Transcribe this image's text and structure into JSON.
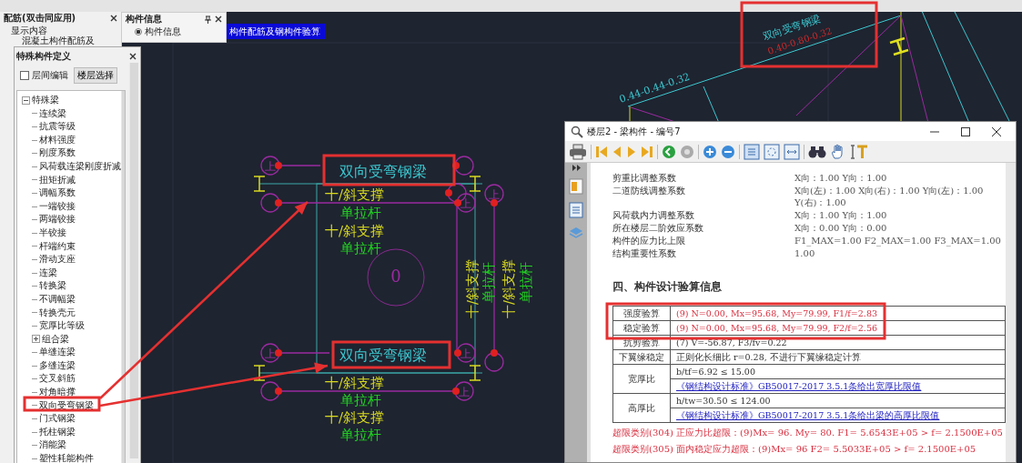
{
  "reinforcement_panel": {
    "title": "配筋(双击同应用)",
    "section_label": "显示内容",
    "tree_item": "混凝土构件配筋及"
  },
  "info_panel": {
    "title": "构件信息",
    "options": [
      {
        "label": "构件信息",
        "selected": true
      }
    ]
  },
  "canvas": {
    "tab_title": "构件配筋及钢构件验算",
    "texts": [
      {
        "kind": "beam",
        "text": "双向受弯钢梁"
      },
      {
        "kind": "brace",
        "text": "十/斜支撑"
      },
      {
        "kind": "tie",
        "text": "单拉杆"
      },
      {
        "kind": "brace",
        "text": "十/斜支撑"
      },
      {
        "kind": "tie",
        "text": "单拉杆"
      },
      {
        "kind": "beam",
        "text": "双向受弯钢梁"
      },
      {
        "kind": "brace",
        "text": "十/斜支撑"
      },
      {
        "kind": "tie",
        "text": "单拉杆"
      },
      {
        "kind": "brace",
        "text": "十/斜支撑"
      },
      {
        "kind": "tie",
        "text": "单拉杆"
      },
      {
        "kind": "brace",
        "text": "十/斜支撑"
      },
      {
        "kind": "tie",
        "text": "单拉杆"
      },
      {
        "kind": "brace",
        "text": "十/斜支撑"
      },
      {
        "kind": "tie",
        "text": "单拉杆"
      },
      {
        "kind": "node",
        "text": "0"
      },
      {
        "kind": "section",
        "text": "0.44-0.44-0.32"
      },
      {
        "kind": "beam",
        "text": "双向受弯钢梁"
      },
      {
        "kind": "section-red",
        "text": "0.40-0.80-0.32"
      }
    ],
    "markers": [
      {
        "kind": "labeled",
        "label": "上"
      },
      {
        "kind": "plain"
      },
      {
        "kind": "plain"
      },
      {
        "kind": "plain"
      },
      {
        "kind": "labeled",
        "label": "上"
      },
      {
        "kind": "labeled",
        "label": "上"
      },
      {
        "kind": "labeled",
        "label": "上"
      },
      {
        "kind": "plain"
      },
      {
        "kind": "labeled",
        "label": "上"
      },
      {
        "kind": "labeled",
        "label": "上"
      },
      {
        "kind": "plain"
      }
    ]
  },
  "special_dialog": {
    "title": "特殊构件定义",
    "checkbox": {
      "label": "层间编辑",
      "checked": false
    },
    "button": "楼层选择",
    "tree": [
      {
        "label": "特殊梁",
        "expanded": true,
        "children": [
          {
            "label": "连续梁"
          },
          {
            "label": "抗震等级"
          },
          {
            "label": "材料强度"
          },
          {
            "label": "刚度系数"
          },
          {
            "label": "风荷载连梁刚度折减"
          },
          {
            "label": "扭矩折减"
          },
          {
            "label": "调幅系数"
          },
          {
            "label": "一端铰接"
          },
          {
            "label": "两端铰接"
          },
          {
            "label": "半铰接"
          },
          {
            "label": "杆端约束"
          },
          {
            "label": "滑动支座"
          },
          {
            "label": "连梁"
          },
          {
            "label": "转换梁"
          },
          {
            "label": "不调幅梁"
          },
          {
            "label": "转换壳元"
          },
          {
            "label": "宽厚比等级"
          },
          {
            "label": "组合梁",
            "expanded": false
          },
          {
            "label": "单缝连梁"
          },
          {
            "label": "多缝连梁"
          },
          {
            "label": "交叉斜筋"
          },
          {
            "label": "对角暗撑"
          },
          {
            "label": "双向受弯钢梁"
          },
          {
            "label": "门式钢梁"
          },
          {
            "label": "托柱钢梁"
          },
          {
            "label": "消能梁"
          },
          {
            "label": "塑性耗能构件"
          }
        ]
      }
    ]
  },
  "report": {
    "title": "楼层2 - 梁构件 - 编号7",
    "params": [
      {
        "label": "剪重比调整系数",
        "value": "X向：1.00 Y向：1.00"
      },
      {
        "label": "二道防线调整系数",
        "value": "X向(左)：1.00 X向(右)：1.00 Y向(左)：1.00 Y(右)：1.00"
      },
      {
        "label": "风荷载内力调整系数",
        "value": "X向：1.00 Y向：1.00"
      },
      {
        "label": "所在楼层二阶效应系数",
        "value": "X向：0.00 Y向：0.00"
      },
      {
        "label": "构件的应力比上限",
        "value": "F1_MAX=1.00  F2_MAX=1.00  F3_MAX=1.00"
      },
      {
        "label": "结构重要性系数",
        "value": "1.00"
      }
    ],
    "section_heading": "四、构件设计验算信息",
    "checks": [
      {
        "label": "强度验算",
        "over_limit": true,
        "lines": [
          {
            "kind": "text",
            "text": "(9)  N=0.00, Mx=95.68, My=79.99, F1/f=2.83"
          }
        ]
      },
      {
        "label": "稳定验算",
        "over_limit": true,
        "lines": [
          {
            "kind": "text",
            "text": "(9)  N=0.00, Mx=95.68, My=79.99, F2/f=2.56"
          }
        ]
      },
      {
        "label": "抗剪验算",
        "over_limit": false,
        "lines": [
          {
            "kind": "text",
            "text": "(7)  V=-56.87, F3/fv=0.22"
          }
        ]
      },
      {
        "label": "下翼缘稳定",
        "over_limit": false,
        "lines": [
          {
            "kind": "text",
            "text": "正则化长细比 r=0.28,   不进行下翼缘稳定计算"
          }
        ]
      },
      {
        "label": "宽厚比",
        "over_limit": false,
        "lines": [
          {
            "kind": "text",
            "text": "b/tf=6.92 ≤ 15.00"
          },
          {
            "kind": "link",
            "text": "《钢结构设计标准》GB50017-2017 3.5.1条给出宽厚比限值"
          }
        ]
      },
      {
        "label": "高厚比",
        "over_limit": false,
        "lines": [
          {
            "kind": "text",
            "text": "h/tw=30.50 ≤ 124.00"
          },
          {
            "kind": "link",
            "text": "《钢结构设计标准》GB50017-2017 3.5.1条给出梁的高厚比限值"
          }
        ]
      }
    ],
    "warnings": [
      "超限类别(304)  正应力比超限：(9)Mx= 96. My= 80.  F1= 5.6543E+05 > f= 2.1500E+05",
      "超限类别(305)  面内稳定应力超限：(9)Mx= 96  F2= 5.5033E+05 > f= 2.1500E+05"
    ]
  },
  "annotations": [
    {
      "kind": "box"
    },
    {
      "kind": "box"
    },
    {
      "kind": "box"
    },
    {
      "kind": "box"
    },
    {
      "kind": "box"
    },
    {
      "kind": "arrow"
    },
    {
      "kind": "arrow"
    }
  ]
}
